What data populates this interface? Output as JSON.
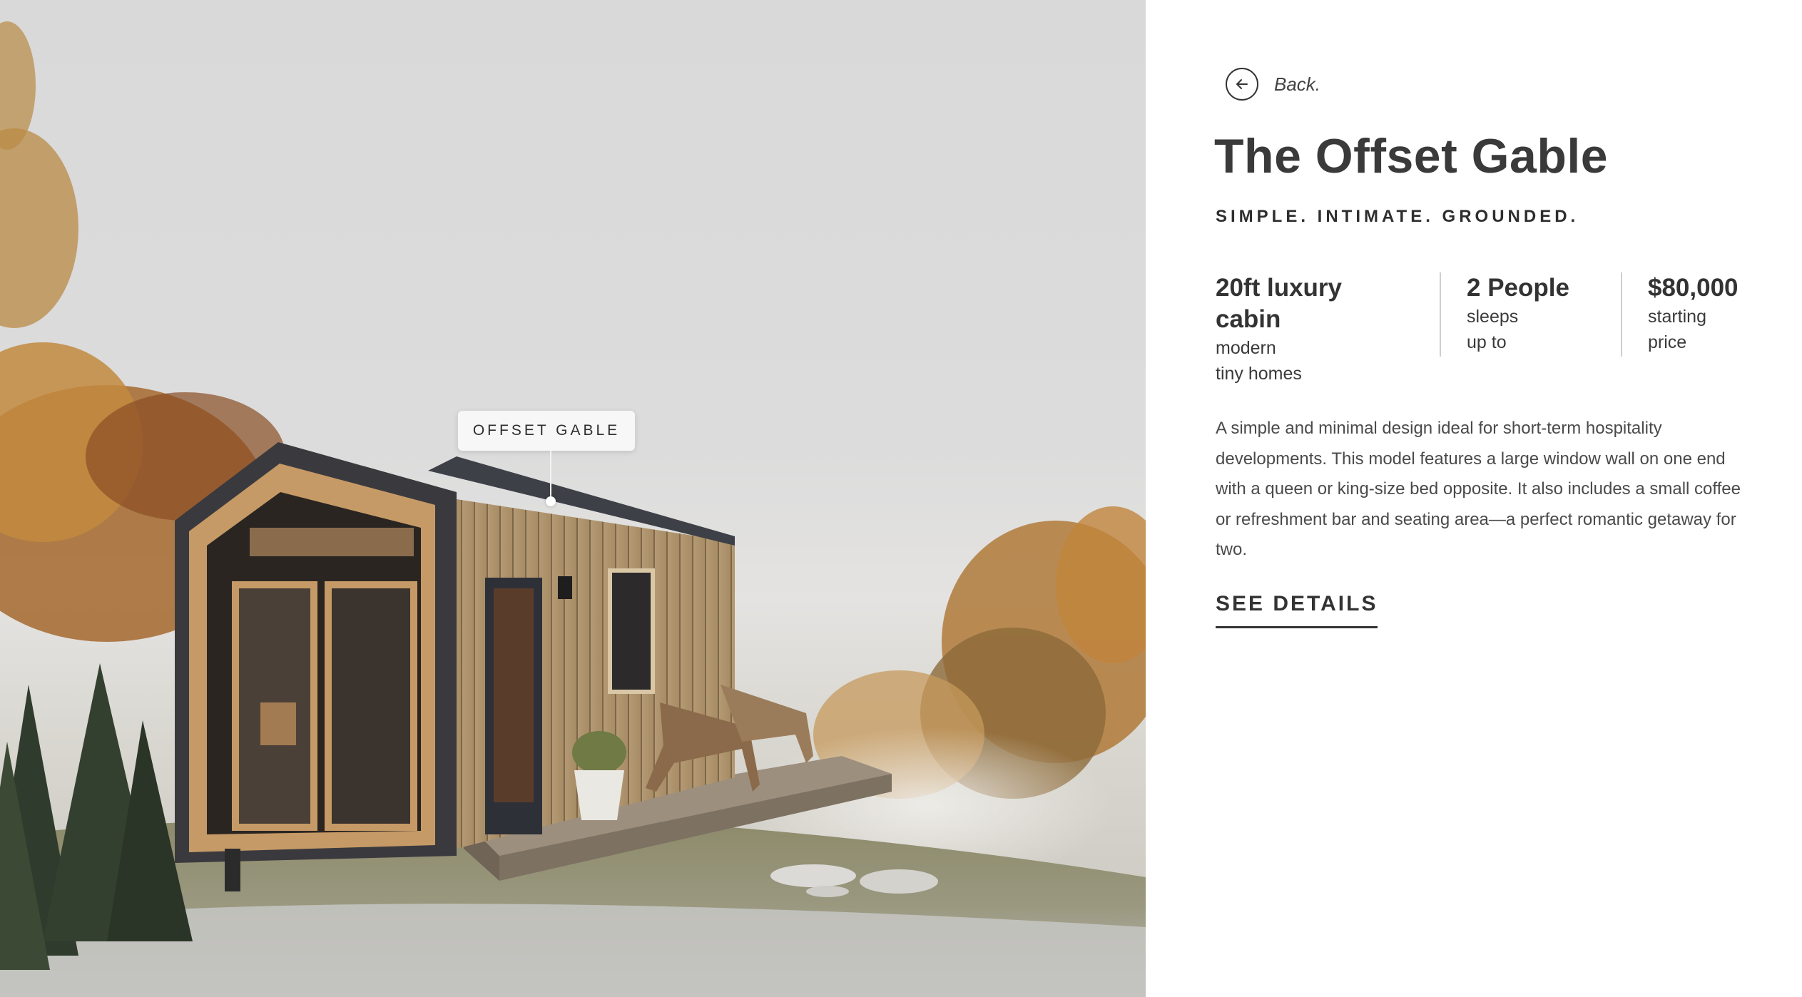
{
  "hero": {
    "tag_label": "OFFSET GABLE"
  },
  "panel": {
    "back_label": "Back.",
    "title": "The Offset Gable",
    "tagline": "SIMPLE. INTIMATE. GROUNDED.",
    "stats": [
      {
        "value": "20ft luxury cabin",
        "label_line1": "modern",
        "label_line2": "tiny homes"
      },
      {
        "value": "2 People",
        "label_line1": "sleeps",
        "label_line2": "up to"
      },
      {
        "value": "$80,000",
        "label_line1": "starting",
        "label_line2": "price"
      }
    ],
    "description": "A simple and minimal design ideal for short-term hospitality developments. This model features a large window wall on one end with a queen or king-size bed opposite. It also includes a small coffee or refreshment bar and seating area—a perfect romantic getaway for two.",
    "cta_label": "SEE DETAILS"
  },
  "icons": {
    "back": "arrow-left-circle-icon"
  }
}
